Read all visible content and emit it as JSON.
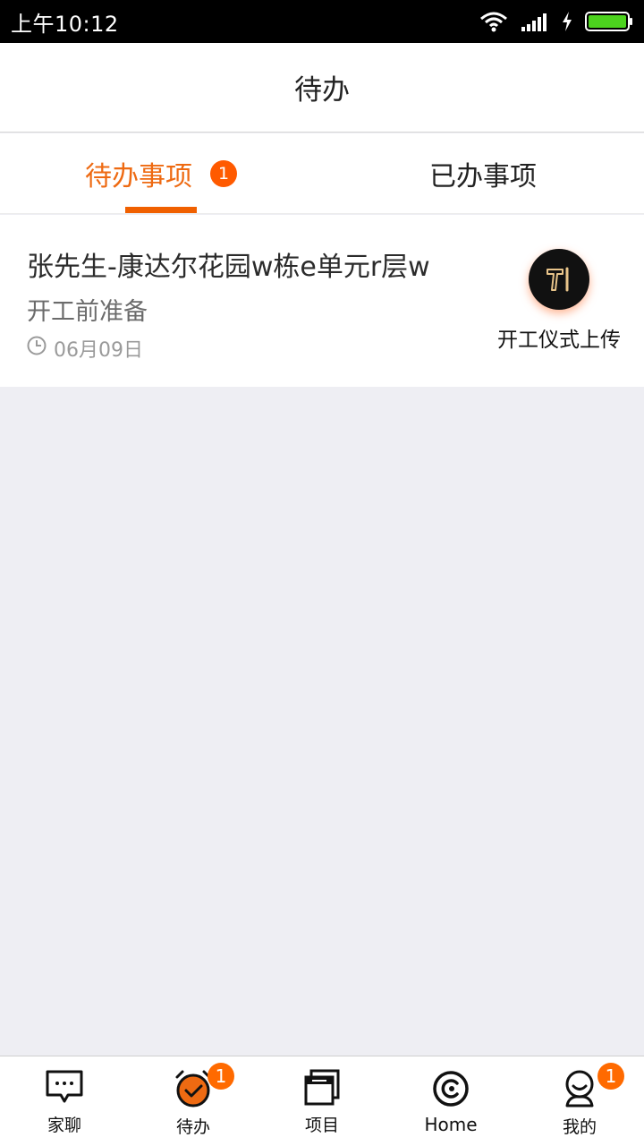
{
  "status_bar": {
    "time": "上午10:12",
    "icons": [
      "wifi-icon",
      "signal-icon",
      "charging-icon",
      "battery-icon"
    ],
    "battery_color": "#4cd31e"
  },
  "header": {
    "title": "待办"
  },
  "tabs": [
    {
      "label": "待办事项",
      "badge": "1",
      "active": true
    },
    {
      "label": "已办事项",
      "active": false
    }
  ],
  "task": {
    "title": "张先生-康达尔花园w栋e单元r层w",
    "stage": "开工前准备",
    "date": "06月09日",
    "action_label": "开工仪式上传",
    "action_icon": "hammer-icon"
  },
  "bottom_nav": [
    {
      "label": "家聊",
      "icon": "chat-icon"
    },
    {
      "label": "待办",
      "icon": "alarm-check-icon",
      "badge": "1"
    },
    {
      "label": "项目",
      "icon": "project-window-icon"
    },
    {
      "label": "Home",
      "icon": "home-ring-icon"
    },
    {
      "label": "我的",
      "icon": "profile-icon",
      "badge": "1"
    }
  ],
  "colors": {
    "accent": "#ee6a12",
    "badge": "#ff5a00",
    "background": "#eeeef3"
  }
}
